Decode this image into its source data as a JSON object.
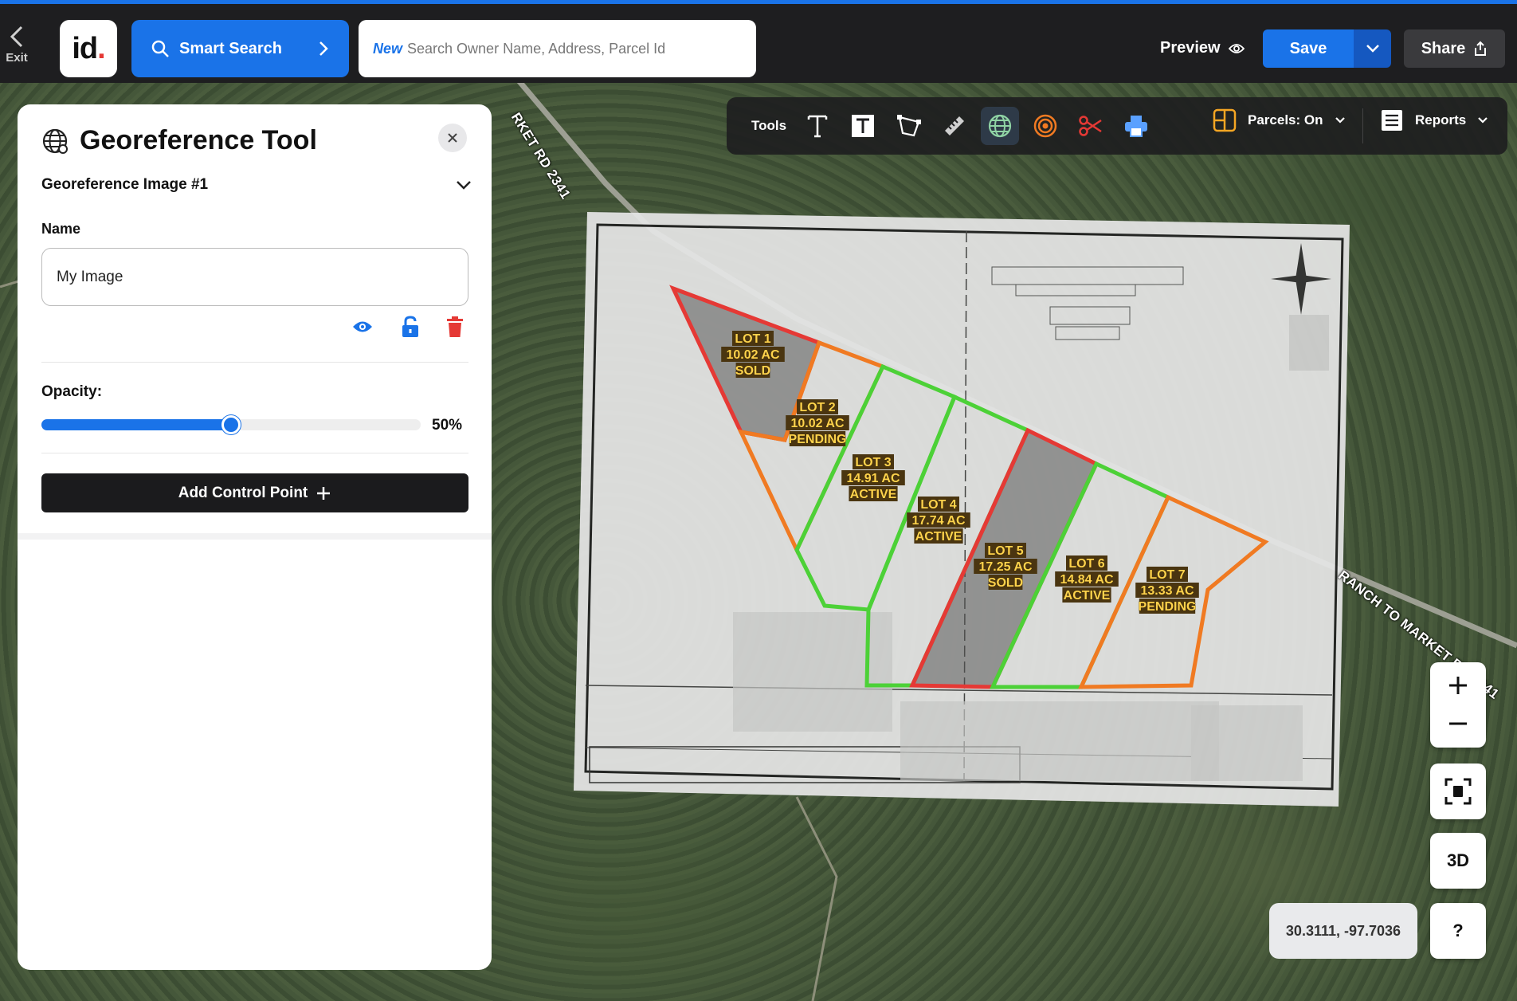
{
  "header": {
    "exit_label": "Exit",
    "logo_text": "id",
    "logo_dot": ".",
    "smart_search_label": "Smart Search",
    "search_new_tag": "New",
    "search_placeholder": "Search Owner Name, Address, Parcel Id",
    "preview_label": "Preview",
    "save_label": "Save",
    "share_label": "Share",
    "accent_color": "#1a73e8"
  },
  "toolbar": {
    "tools_label": "Tools",
    "tools": [
      "text-icon",
      "text-box-icon",
      "polygon-icon",
      "ruler-icon",
      "georeference-globe-icon",
      "buffer-rings-icon",
      "scissors-icon",
      "print-icon"
    ],
    "active_tool": "georeference-globe-icon",
    "parcels_label": "Parcels: On",
    "reports_label": "Reports"
  },
  "panel": {
    "title": "Georeference Tool",
    "image_selector": "Georeference Image #1",
    "name_label": "Name",
    "name_value": "My Image",
    "opacity_label": "Opacity:",
    "opacity_value": "50%",
    "opacity_fraction": 0.5,
    "add_control_point_label": "Add Control Point"
  },
  "map": {
    "road_labels": [
      "RKET RD 2341",
      "RANCH TO MARKET RD 2341"
    ],
    "overlay_lots": [
      {
        "label": "LOT 1",
        "acres": "10.02 AC",
        "status": "SOLD"
      },
      {
        "label": "LOT 2",
        "acres": "10.02 AC",
        "status": "PENDING"
      },
      {
        "label": "LOT 3",
        "acres": "14.91 AC",
        "status": "ACTIVE"
      },
      {
        "label": "LOT 4",
        "acres": "17.74 AC",
        "status": "ACTIVE"
      },
      {
        "label": "LOT 5",
        "acres": "17.25 AC",
        "status": "SOLD"
      },
      {
        "label": "LOT 6",
        "acres": "14.84 AC",
        "status": "ACTIVE"
      },
      {
        "label": "LOT 7",
        "acres": "13.33 AC",
        "status": "PENDING"
      }
    ],
    "status_colors": {
      "SOLD": "#e53935",
      "PENDING": "#f07a22",
      "ACTIVE": "#4cd137"
    },
    "coordinates": "30.3111, -97.7036",
    "three_d_label": "3D",
    "help_label": "?"
  }
}
